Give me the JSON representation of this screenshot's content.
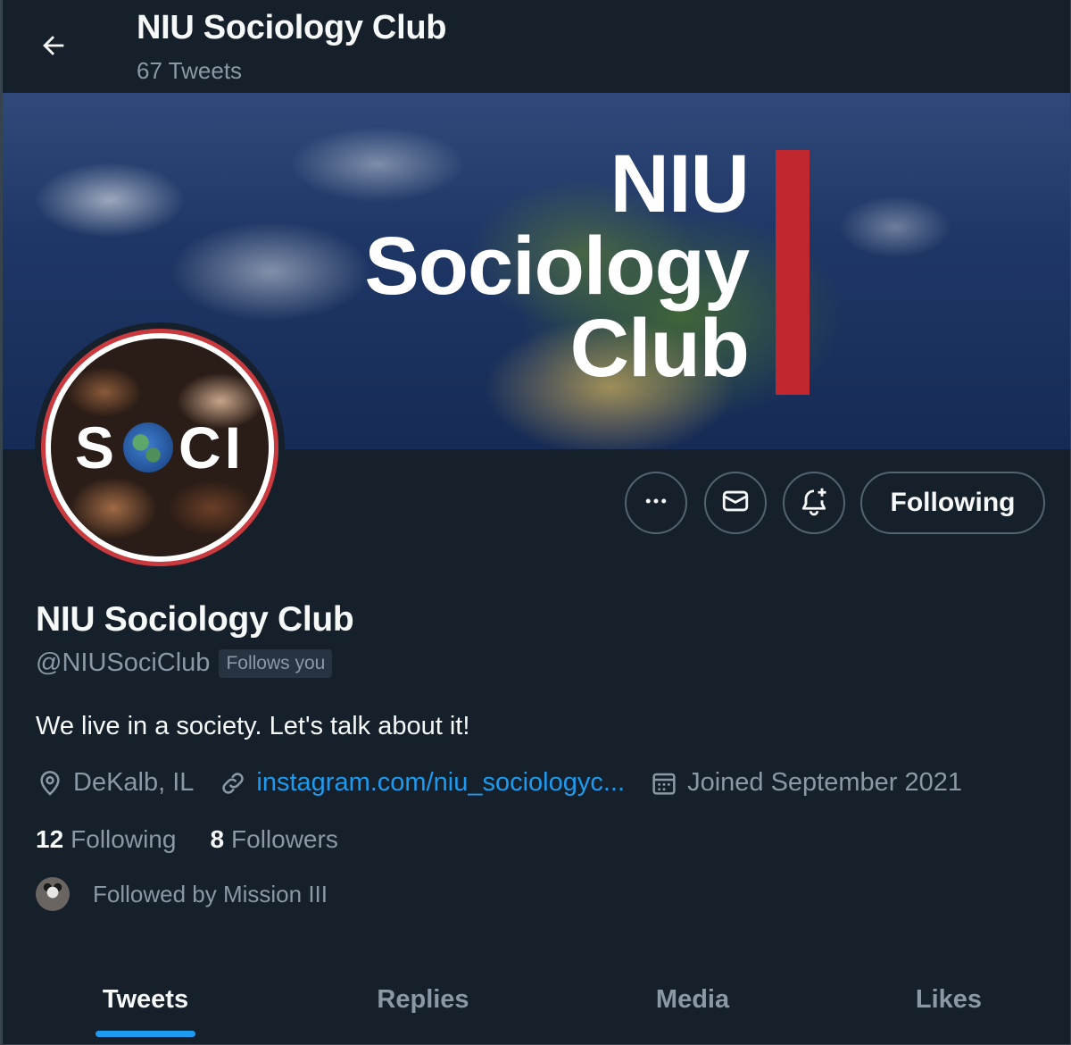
{
  "header": {
    "title": "NIU Sociology Club",
    "tweet_count": "67 Tweets"
  },
  "banner": {
    "line1": "NIU",
    "line2": "Sociology",
    "line3": "Club",
    "accent_color": "#c0272f"
  },
  "avatar": {
    "text_left": "S",
    "text_right": "CI"
  },
  "actions": {
    "more_icon": "more-icon",
    "message_icon": "mail-icon",
    "notify_icon": "bell-plus-icon",
    "following_label": "Following"
  },
  "profile": {
    "display_name": "NIU Sociology Club",
    "handle": "@NIUSociClub",
    "follows_you": "Follows you",
    "bio": "We live in a society. Let's talk about it!",
    "location": "DeKalb, IL",
    "link": "instagram.com/niu_sociologyc...",
    "joined": "Joined September 2021"
  },
  "stats": {
    "following_count": "12",
    "following_label": "Following",
    "followers_count": "8",
    "followers_label": "Followers"
  },
  "followed_by": "Followed by Mission III",
  "tabs": [
    {
      "label": "Tweets",
      "active": true
    },
    {
      "label": "Replies",
      "active": false
    },
    {
      "label": "Media",
      "active": false
    },
    {
      "label": "Likes",
      "active": false
    }
  ],
  "colors": {
    "background": "#15202b",
    "link": "#1d9bf0",
    "muted": "#8b98a5"
  }
}
